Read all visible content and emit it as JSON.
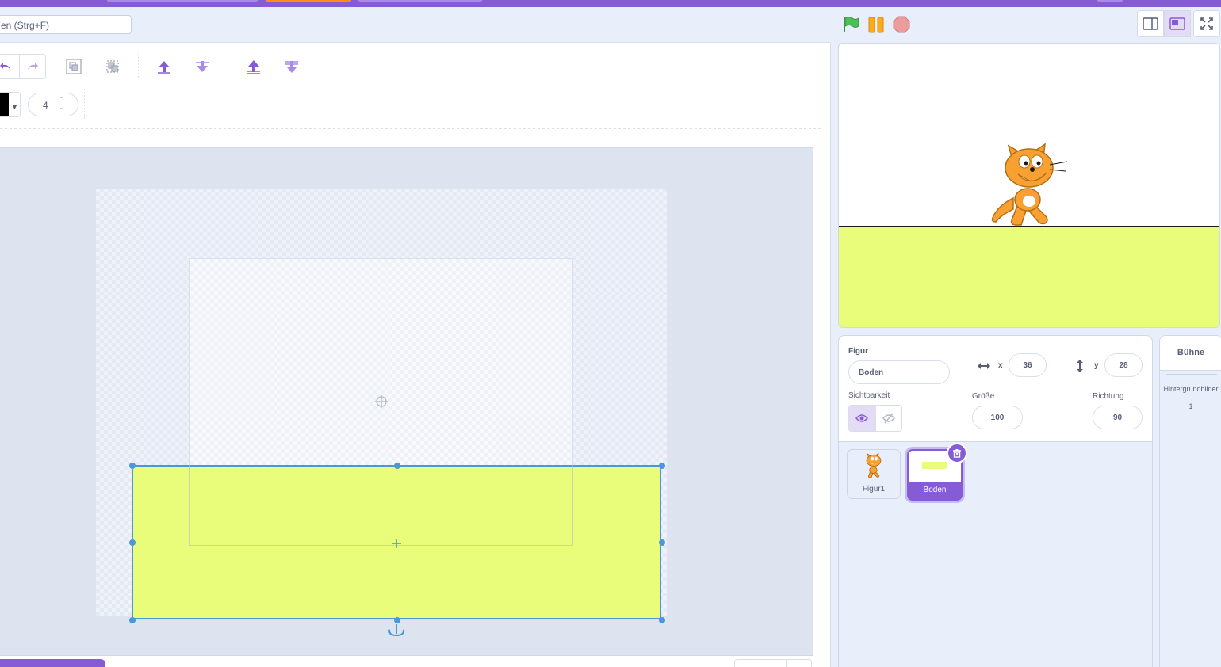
{
  "search": {
    "text": "en (Strg+F)"
  },
  "paint_editor": {
    "stroke_width": "4"
  },
  "stage": {
    "sprite_name": "Figur1"
  },
  "sprite_info": {
    "sprite_label": "Figur",
    "sprite_name_value": "Boden",
    "x_label": "x",
    "x_value": "36",
    "y_label": "y",
    "y_value": "28",
    "visibility_label": "Sichtbarkeit",
    "size_label": "Größe",
    "size_value": "100",
    "direction_label": "Richtung",
    "direction_value": "90"
  },
  "sprites": [
    {
      "name": "Figur1",
      "selected": false
    },
    {
      "name": "Boden",
      "selected": true
    }
  ],
  "stage_panel": {
    "title": "Bühne",
    "backdrops_label": "Hintergrundbilder",
    "backdrops_count": "1"
  },
  "colors": {
    "accent": "#855cd6",
    "ground": "#eafd7a",
    "selection": "#4c97d8",
    "flag": "#4cbf56",
    "pause": "#ffab19",
    "stop": "#ec9c9c"
  }
}
